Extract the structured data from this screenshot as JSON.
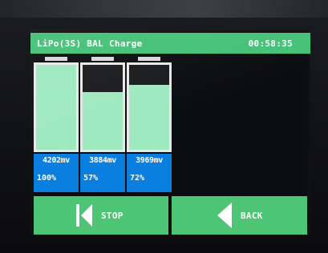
{
  "header": {
    "title": "LiPo(3S) BAL Charge",
    "timer": "00:58:35"
  },
  "cells": [
    {
      "voltage": "4202mv",
      "percent": "100%",
      "fill": 1.0
    },
    {
      "voltage": "3884mv",
      "percent": "57%",
      "fill": 0.68
    },
    {
      "voltage": "3969mv",
      "percent": "72%",
      "fill": 0.76
    }
  ],
  "buttons": {
    "stop_label": "STOP",
    "back_label": "BACK"
  },
  "colors": {
    "header_bg": "#45c178",
    "button_bg": "#4dc574",
    "cell_fill": "#9ee9c0",
    "info_bg": "#0b7fe0"
  },
  "icons": {
    "stop": "skip-to-start-icon",
    "back": "back-arrow-icon"
  }
}
